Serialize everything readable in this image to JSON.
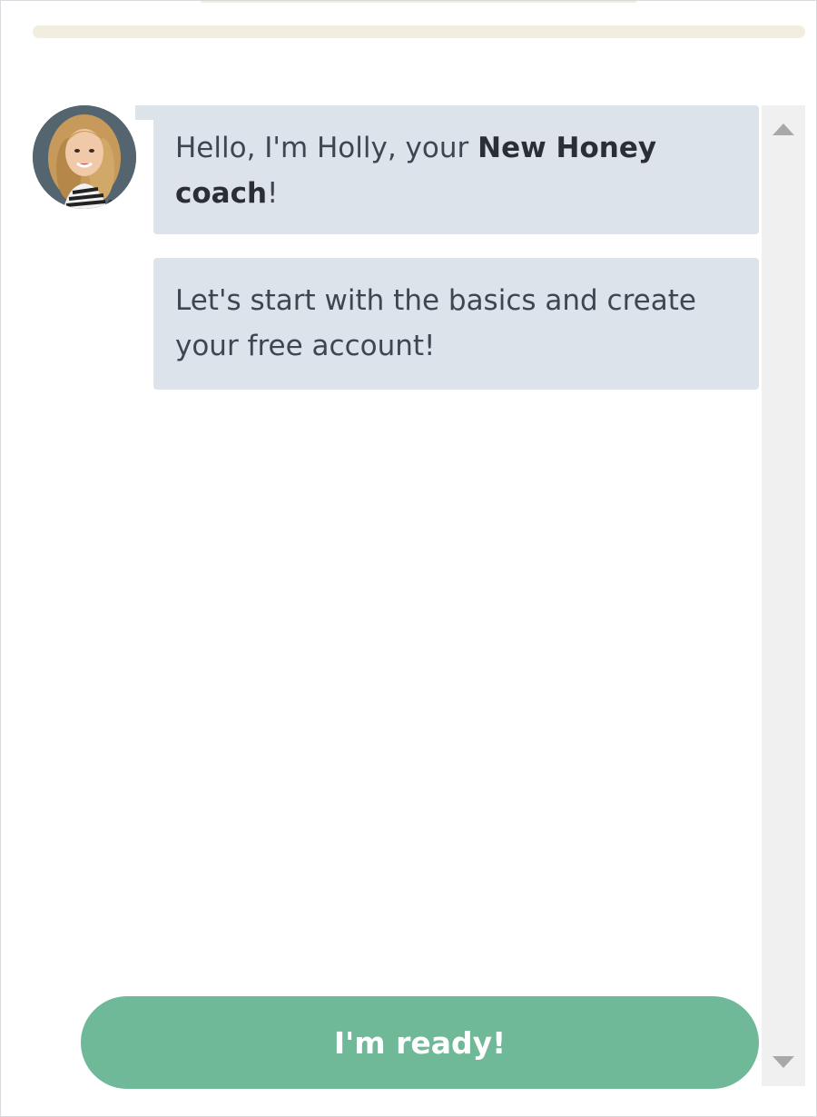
{
  "progress": {
    "fraction": 0.0
  },
  "coach": {
    "avatar_icon": "coach-avatar-photo"
  },
  "messages": [
    {
      "text_before": "Hello, I'm Holly, your ",
      "text_bold": "New Honey coach",
      "text_after": "!"
    },
    {
      "text_line_1": "Let's start with the basics and create",
      "text_line_2": "your free account!"
    }
  ],
  "actions": {
    "ready_label": "I'm ready!"
  },
  "colors": {
    "accent": "#6fb898",
    "bubble": "#dde3ea",
    "progress_track": "#f2eedf"
  },
  "scrollbar": {
    "up_icon": "scroll-up-arrow-icon",
    "down_icon": "scroll-down-arrow-icon"
  }
}
